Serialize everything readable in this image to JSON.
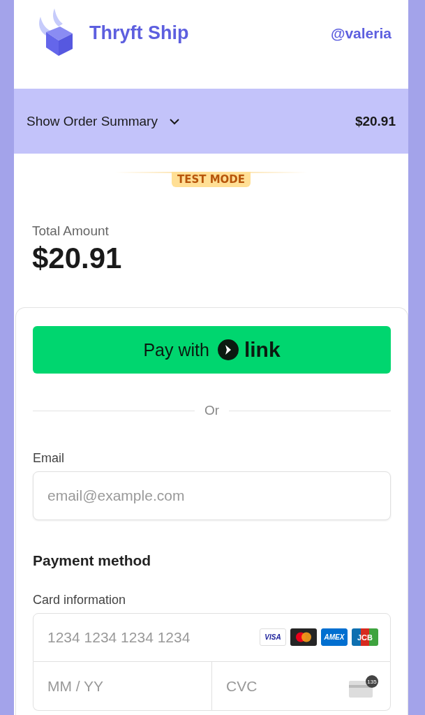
{
  "header": {
    "brand": "Thryft Ship",
    "user": "@valeria"
  },
  "summary_bar": {
    "label": "Show Order Summary",
    "expanded": false,
    "amount": "$20.91"
  },
  "test_mode": "TEST MODE",
  "total": {
    "label": "Total Amount",
    "amount": "$20.91"
  },
  "pay_button": {
    "text": "Pay with",
    "brand": "link"
  },
  "divider": "Or",
  "email": {
    "label": "Email",
    "placeholder": "email@example.com"
  },
  "payment_method": "Payment method",
  "card": {
    "label": "Card information",
    "number_placeholder": "1234 1234 1234 1234",
    "expiry_placeholder": "MM / YY",
    "cvc_placeholder": "CVC",
    "cvc_hint": "135",
    "brands": [
      {
        "kind": "visa",
        "text": "VISA"
      },
      {
        "kind": "mastercard"
      },
      {
        "kind": "amex",
        "text": "AMEX"
      },
      {
        "kind": "jcb",
        "text": "JCB"
      }
    ]
  }
}
